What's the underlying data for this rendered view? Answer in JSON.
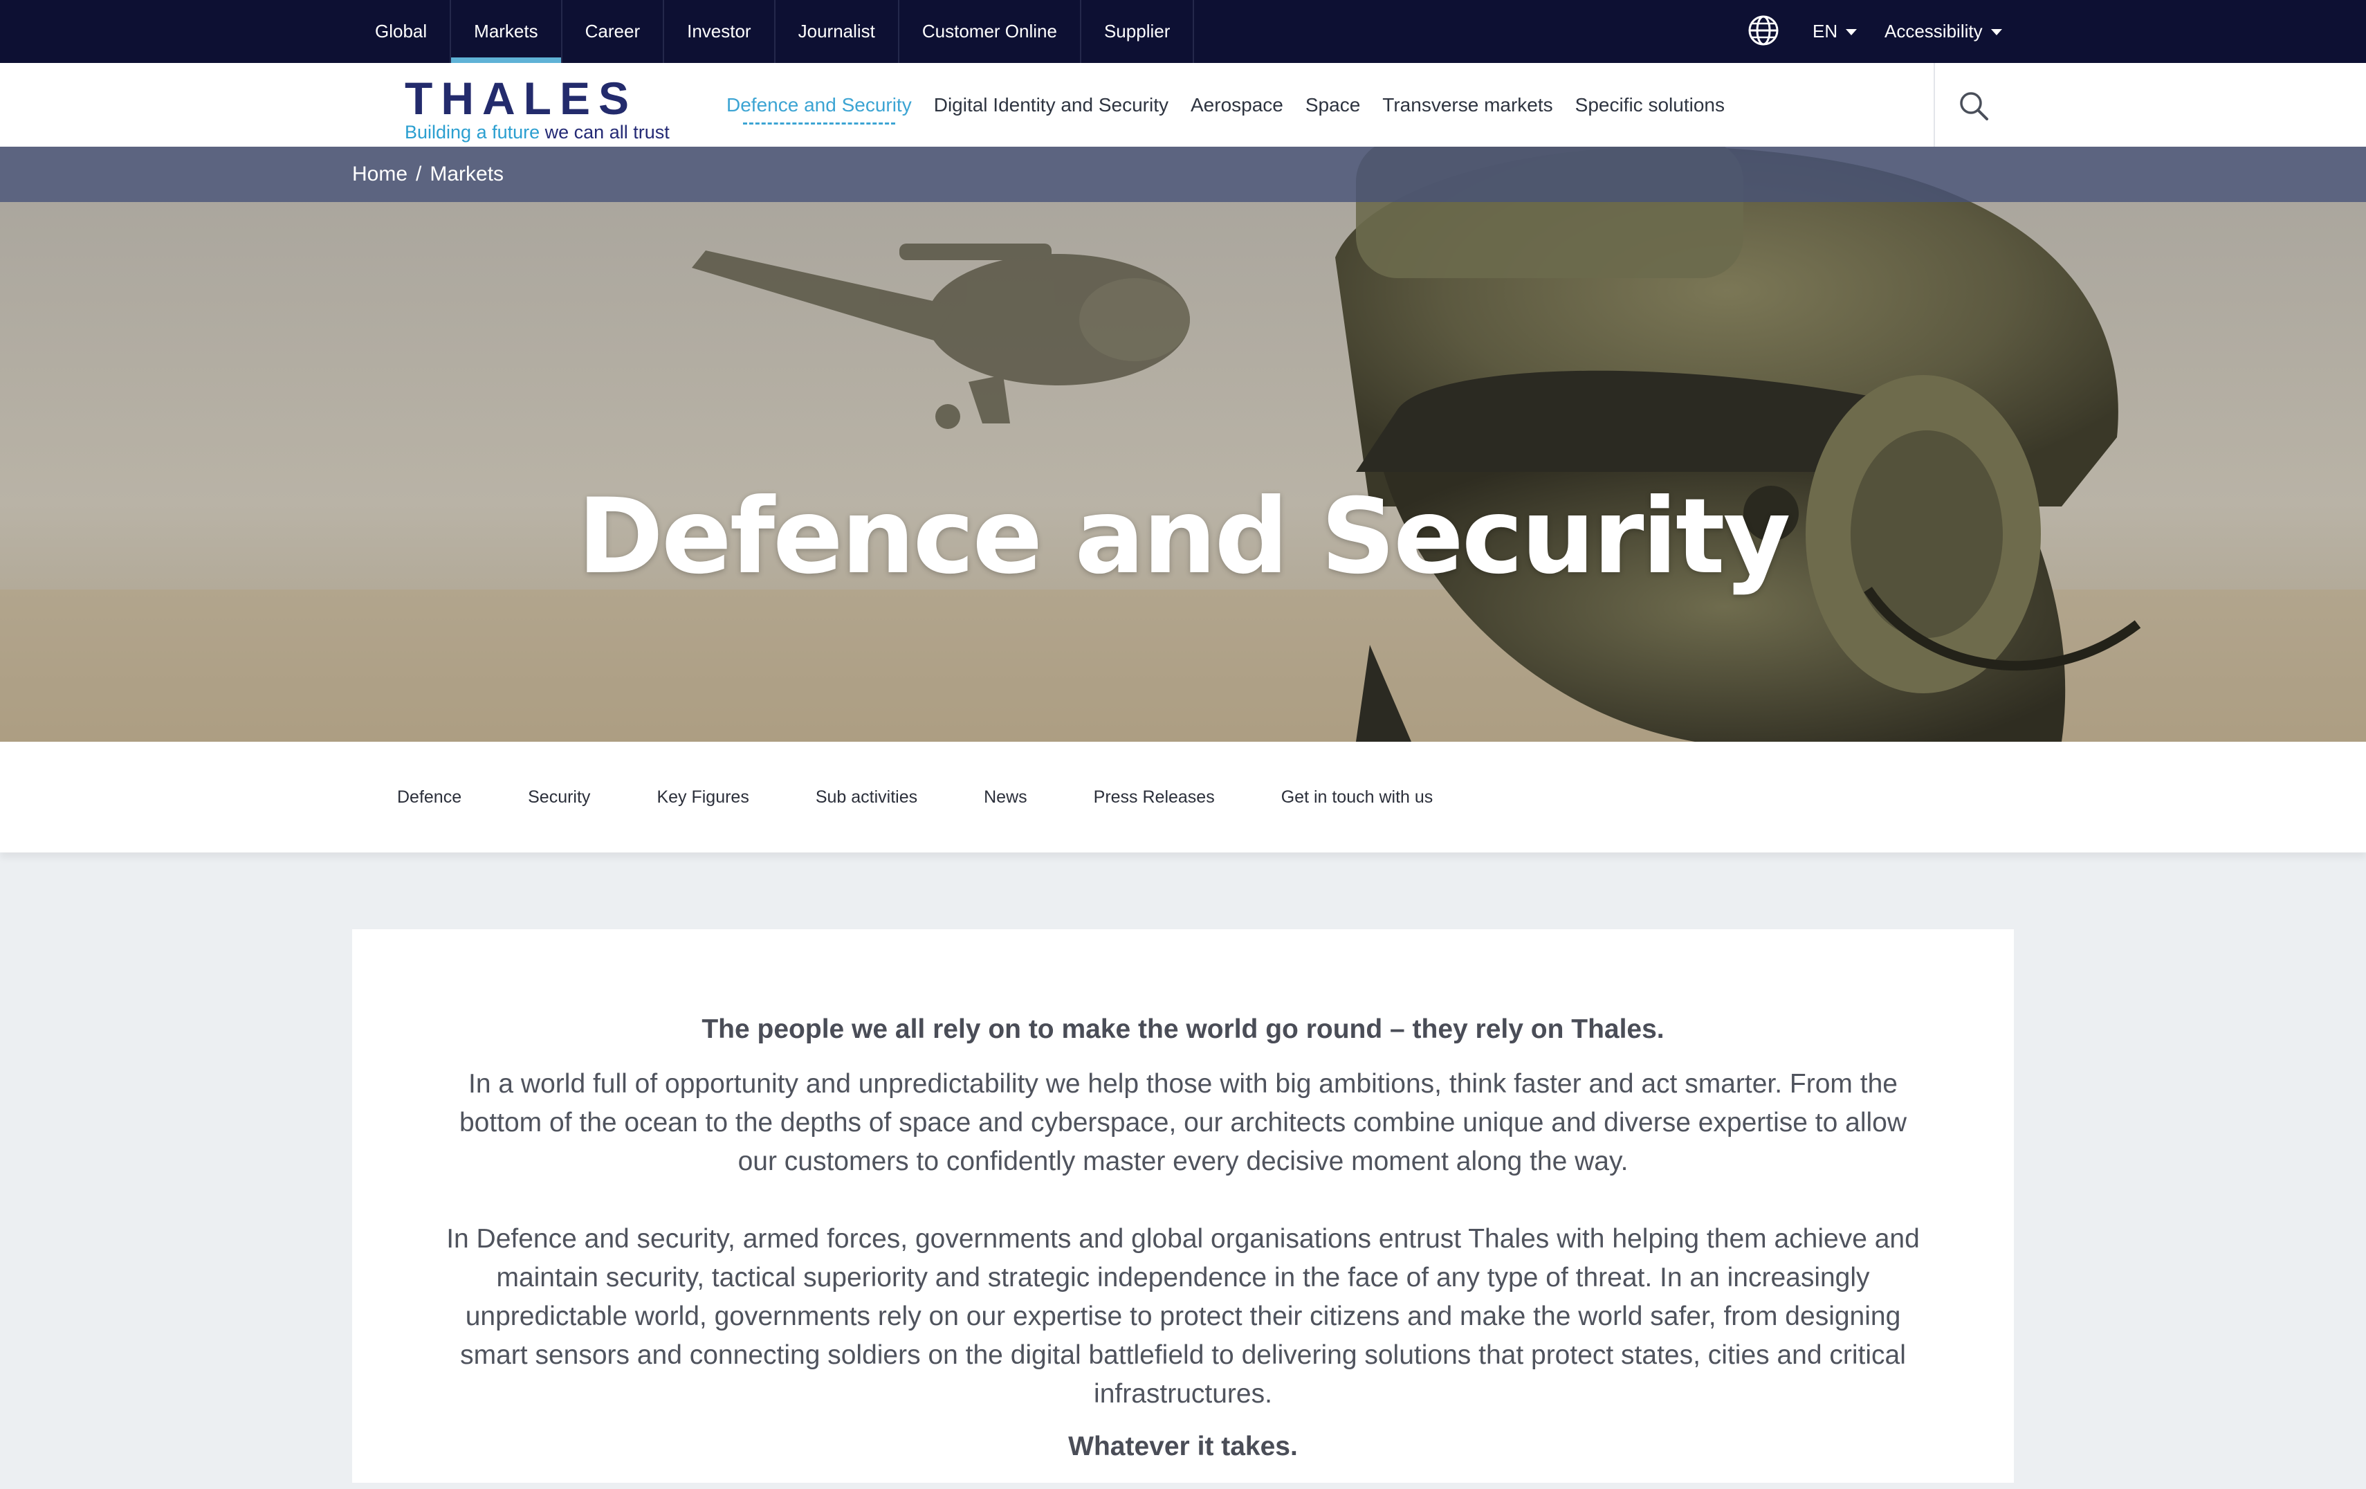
{
  "top_nav": {
    "items": [
      "Global",
      "Markets",
      "Career",
      "Investor",
      "Journalist",
      "Customer Online",
      "Supplier"
    ],
    "active": "Markets",
    "language": "EN",
    "accessibility": "Accessibility"
  },
  "brand": {
    "wordmark": "THALES",
    "tagline_part1": "Building a future",
    "tagline_part2": " we can all trust"
  },
  "main_nav": {
    "items": [
      "Defence and Security",
      "Digital Identity and Security",
      "Aerospace",
      "Space",
      "Transverse markets",
      "Specific solutions"
    ],
    "active": "Defence and Security"
  },
  "breadcrumb": {
    "home": "Home",
    "separator": "/",
    "current": "Markets"
  },
  "hero": {
    "title": "Defence and Security"
  },
  "sub_nav": {
    "items": [
      "Defence",
      "Security",
      "Key Figures",
      "Sub activities",
      "News",
      "Press Releases",
      "Get in touch with us"
    ]
  },
  "content": {
    "lead": "The people we all rely on to make the world go round – they rely on Thales.",
    "paragraph_1": "In a world full of opportunity and unpredictability we help those with big ambitions, think faster and act smarter. From the bottom of the ocean to the depths of space and cyberspace, our architects combine unique and diverse expertise to allow our customers to confidently master every decisive moment along the way.",
    "paragraph_2": "In Defence and security, armed forces, governments and global organisations entrust Thales with helping them achieve and maintain security, tactical superiority and strategic independence in the face of any type of threat. In an increasingly unpredictable world, governments rely on our expertise to protect their citizens and make the world safer, from designing smart sensors and connecting soldiers on the digital battlefield to delivering solutions that protect states, cities and critical infrastructures.",
    "closing": "Whatever it takes."
  },
  "colors": {
    "top_bar": "#0d1033",
    "accent": "#3ca4d3",
    "brand_navy": "#232b6c",
    "page_background": "#eceff2"
  },
  "icons": [
    "globe-icon",
    "caret-down-icon",
    "search-icon"
  ]
}
